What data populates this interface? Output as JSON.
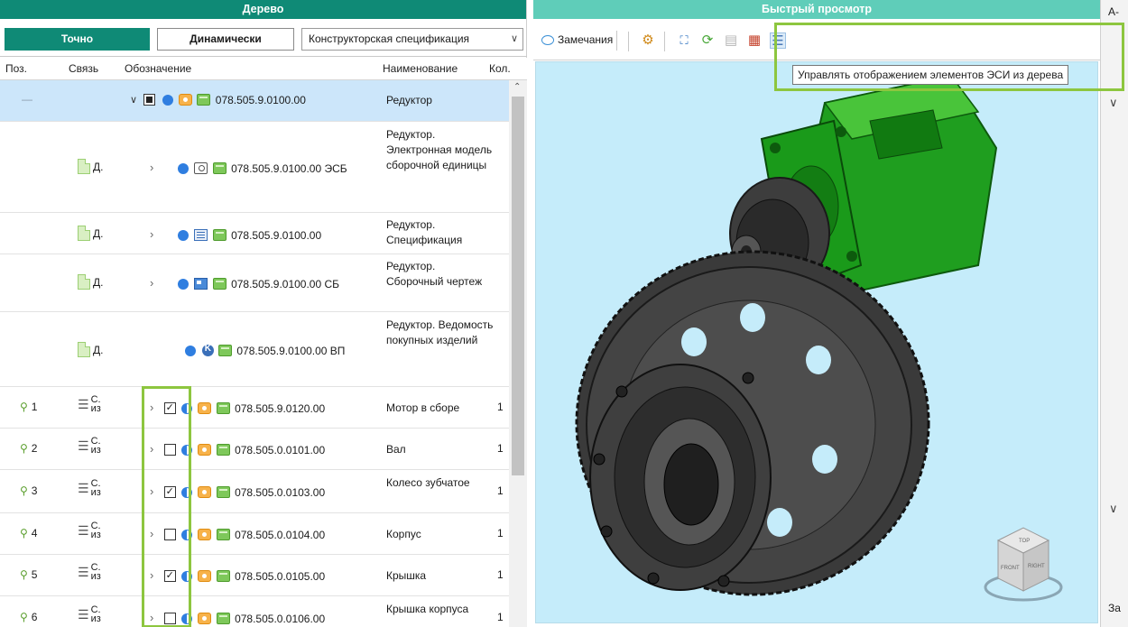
{
  "left_panel": {
    "title": "Дерево",
    "exact_button": "Точно",
    "dynamic_button": "Динамически",
    "spec_select": "Конструкторская спецификация",
    "columns": {
      "pos": "Поз.",
      "link": "Связь",
      "designation": "Обозначение",
      "name": "Наименование",
      "qty": "Кол."
    },
    "root": {
      "pos": "—",
      "designation": "078.505.9.0100.00",
      "name": "Редуктор"
    },
    "doc_rows": [
      {
        "link": "Д.",
        "designation": "078.505.9.0100.00 ЭСБ",
        "name": "Редуктор. Электронная модель сборочной единицы"
      },
      {
        "link": "Д.",
        "designation": "078.505.9.0100.00",
        "name": "Редуктор. Спецификация"
      },
      {
        "link": "Д.",
        "designation": "078.505.9.0100.00 СБ",
        "name": "Редуктор. Сборочный чертеж"
      },
      {
        "link": "Д.",
        "designation": "078.505.9.0100.00 ВП",
        "name": "Редуктор. Ведомость покупных изделий"
      }
    ],
    "part_rows": [
      {
        "pos": "1",
        "link_top": "С.",
        "link_bottom": "из",
        "checked": true,
        "designation": "078.505.9.0120.00",
        "name": "Мотор в сборе",
        "qty": "1"
      },
      {
        "pos": "2",
        "link_top": "С.",
        "link_bottom": "из",
        "checked": false,
        "designation": "078.505.0.0101.00",
        "name": "Вал",
        "qty": "1"
      },
      {
        "pos": "3",
        "link_top": "С.",
        "link_bottom": "из",
        "checked": true,
        "designation": "078.505.0.0103.00",
        "name": "Колесо зубчатое",
        "qty": "1"
      },
      {
        "pos": "4",
        "link_top": "С.",
        "link_bottom": "из",
        "checked": false,
        "designation": "078.505.0.0104.00",
        "name": "Корпус",
        "qty": "1"
      },
      {
        "pos": "5",
        "link_top": "С.",
        "link_bottom": "из",
        "checked": true,
        "designation": "078.505.0.0105.00",
        "name": "Крышка",
        "qty": "1"
      },
      {
        "pos": "6",
        "link_top": "С.",
        "link_bottom": "из",
        "checked": false,
        "designation": "078.505.0.0106.00",
        "name": "Крышка корпуса",
        "qty": "1"
      }
    ]
  },
  "right_panel": {
    "title": "Быстрый просмотр",
    "remarks_button": "Замечания",
    "tooltip": "Управлять отображением элементов ЭСИ из дерева",
    "view_cube": {
      "top": "TOP",
      "front": "FRONT",
      "right": "RIGHT"
    }
  },
  "far_right": {
    "top_text": "А-",
    "bottom_text": "За"
  },
  "colors": {
    "teal": "#0f8a76",
    "teal_light": "#5fcdb9",
    "highlight": "#8dc63f",
    "viewport_bg": "#c5ecfa",
    "selection": "#cce6fa"
  }
}
